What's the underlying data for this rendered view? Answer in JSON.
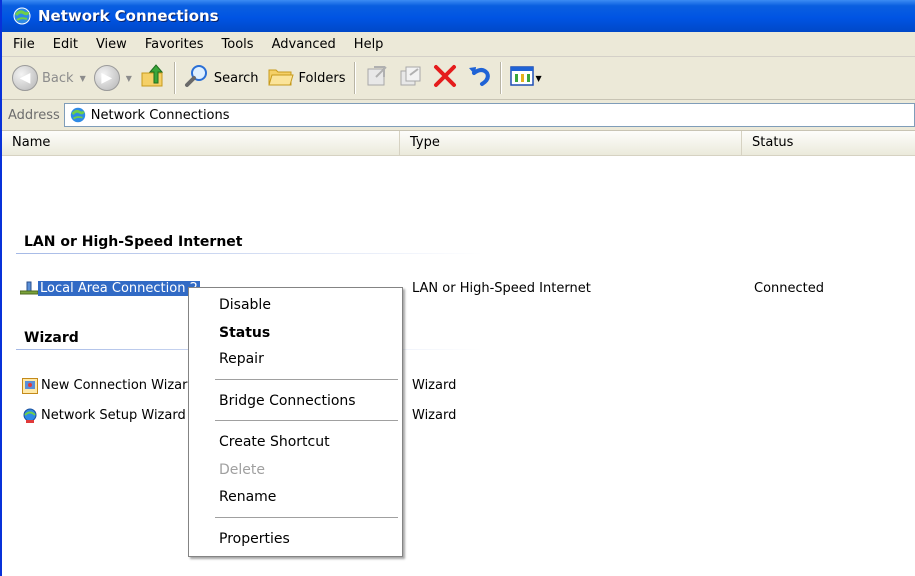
{
  "window": {
    "title": "Network Connections"
  },
  "menu": {
    "items": [
      "File",
      "Edit",
      "View",
      "Favorites",
      "Tools",
      "Advanced",
      "Help"
    ]
  },
  "toolbar": {
    "back_label": "Back",
    "search_label": "Search",
    "folders_label": "Folders"
  },
  "address": {
    "label": "Address",
    "value": "Network Connections"
  },
  "columns": {
    "name": "Name",
    "type": "Type",
    "status": "Status"
  },
  "groups": [
    {
      "title": "LAN or High-Speed Internet",
      "items": [
        {
          "name": "Local Area Connection 2",
          "type": "LAN or High-Speed Internet",
          "status": "Connected"
        }
      ]
    },
    {
      "title": "Wizard",
      "items": [
        {
          "name": "New Connection Wizard",
          "type": "Wizard",
          "status": ""
        },
        {
          "name": "Network Setup Wizard",
          "type": "Wizard",
          "status": ""
        }
      ]
    }
  ],
  "context_menu": {
    "items": [
      "Disable",
      "Status",
      "Repair",
      "Bridge Connections",
      "Create Shortcut",
      "Delete",
      "Rename",
      "Properties"
    ]
  },
  "colors": {
    "title_bar": "#0054e3",
    "selection": "#316ac5",
    "delete_icon": "#e51c1c"
  }
}
